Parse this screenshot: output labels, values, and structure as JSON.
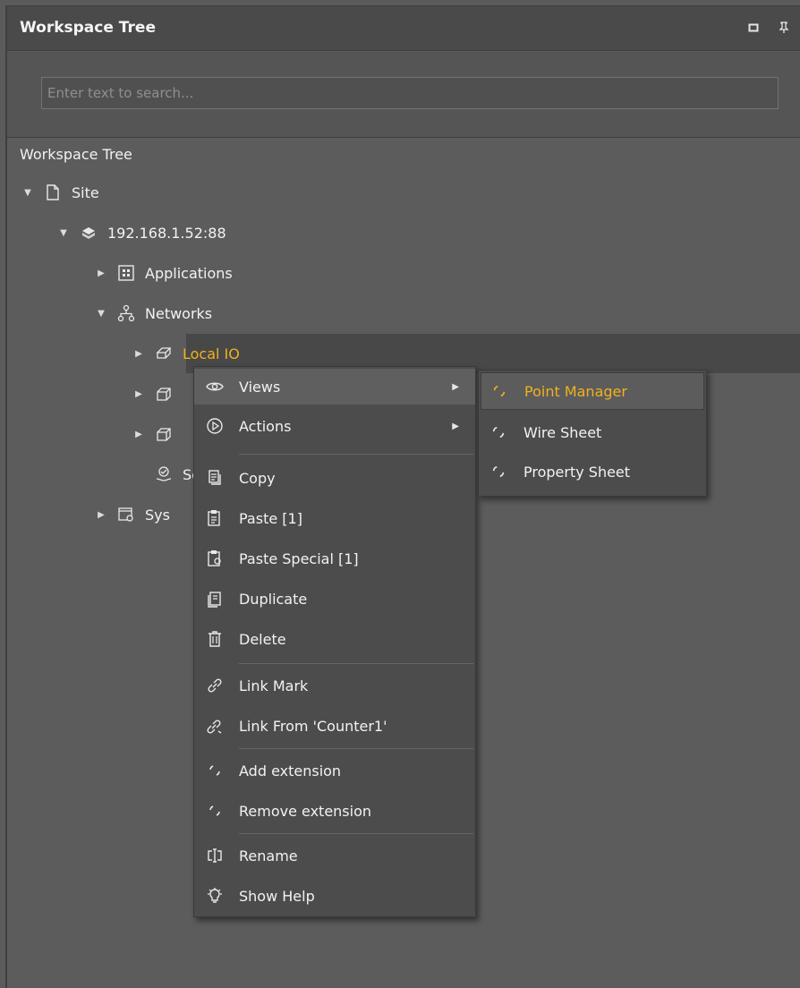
{
  "panel": {
    "title": "Workspace Tree",
    "search_placeholder": "Enter text to search...",
    "section_label": "Workspace Tree"
  },
  "tree": {
    "site": "Site",
    "station": "192.168.1.52:88",
    "applications": "Applications",
    "networks": "Networks",
    "local_io": "Local IO",
    "services_partial": "Ser",
    "system_partial": "Sys"
  },
  "context_menu": {
    "views": "Views",
    "actions": "Actions",
    "copy": "Copy",
    "paste": "Paste [1]",
    "paste_special": "Paste Special [1]",
    "duplicate": "Duplicate",
    "delete": "Delete",
    "link_mark": "Link Mark",
    "link_from": "Link From 'Counter1'",
    "add_extension": "Add extension",
    "remove_extension": "Remove extension",
    "rename": "Rename",
    "show_help": "Show Help"
  },
  "views_submenu": {
    "point_manager": "Point Manager",
    "wire_sheet": "Wire Sheet",
    "property_sheet": "Property Sheet"
  },
  "colors": {
    "accent": "#f0b21d",
    "panel_bg": "#5c5c5c",
    "menu_bg": "#4c4c4c"
  }
}
